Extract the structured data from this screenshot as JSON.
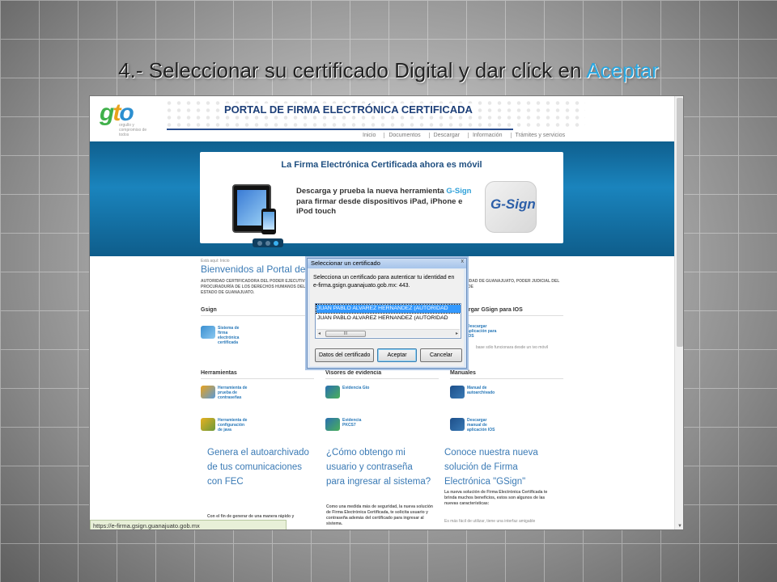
{
  "slide": {
    "title_prefix": "4.- Seleccionar su certificado Digital y dar click en ",
    "title_accent": "Aceptar",
    "accent_color": "#2aa7e0"
  },
  "site": {
    "logo": "gto",
    "logo_tagline": "orgullo y compromiso de todos",
    "portal_title": "PORTAL DE FIRMA ELECTRÓNICA CERTIFICADA",
    "nav": [
      "Inicio",
      "Documentos",
      "Descargar",
      "Información",
      "Trámites y servicios"
    ],
    "banner": {
      "heading": "La Firma Electrónica Certificada ahora es móvil",
      "text_a": "Descarga y prueba la nueva herramienta ",
      "text_brand": "G-Sign",
      "text_b": " para firmar desde dispositivos iPad, iPhone e iPod touch",
      "tile": "G-Sign"
    },
    "crumb": "Está aquí: Inicio",
    "welcome": "Bienvenidos al Portal de",
    "intro_left": "AUTORIDAD CERTIFICADORA DEL PODER EJECUTIVO, PROCURADURÍA DE LOS DERECHOS HUMANOS DEL ESTADO DE GUANAJUATO.",
    "intro_right": "UNIVERSIDAD DE GUANAJUATO, PODER JUDICIAL DEL ESTADO DE",
    "sections": {
      "gsign": "Gsign",
      "gsign_ios": "argar GSign para IOS",
      "tools": "Herramientas",
      "viewers": "Visores de evidencia",
      "manuals": "Manuales"
    },
    "tools": {
      "gsign_system": "Sistema de firma electrónica certificada",
      "download_ios": "Descargar aplicación para IOS",
      "ios_note": "base sólo funcionara desde un ivo móvil",
      "test_tool": "Herramienta de prueba de contraseñas",
      "java_tool": "Herramienta de configuración de java",
      "evidence_gto": "Evidencia Gto",
      "evidence_pkcs7": "Evidencia PKCS7",
      "manual_self": "Manual de autoarchivado",
      "manual_ios": "Descargar manual de aplicación IOS"
    },
    "features": {
      "f1": "Genera el autoarchivado de tus comunicaciones con FEC",
      "f1_body": "Con el fin de generar de una manera rápido y",
      "f2": "¿Cómo obtengo mi usuario y contraseña para ingresar al sistema?",
      "f2_body": "Como una medida más de seguridad, la nueva solución de Firma Electrónica Certificada, te solicita usuario y contraseña además del certificado para ingresar al sistema.",
      "f3": "Conoce nuestra nueva solución de Firma Electrónica \"GSign\"",
      "f3_body": "La nueva solución de Firma Electrónica Certificada te brinda muchos beneficios, estos son algunos de las nuevas características:",
      "f3_extra": "Es más fácil de utilizar, tiene una interfaz amigable"
    },
    "status_url": "https://e-firma.gsign.guanajuato.gob.mx"
  },
  "dialog": {
    "title": "Seleccionar un certificado",
    "close": "x",
    "message": "Selecciona un certificado para autenticar tu identidad en e-firma.gsign.guanajuato.gob.mx: 443.",
    "certificates": [
      "JUAN PABLO ALVAREZ HERNANDEZ (AUTORIDAD",
      "JUAN PABLO ALVAREZ HERNANDEZ (AUTORIDAD"
    ],
    "scroll_thumb": "III",
    "buttons": {
      "details": "Datos del certificado",
      "accept": "Aceptar",
      "cancel": "Cancelar"
    }
  }
}
